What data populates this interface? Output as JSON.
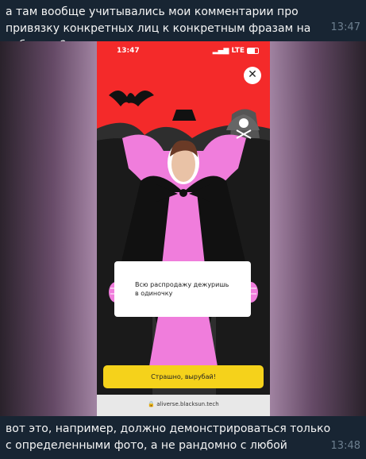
{
  "top_message": {
    "text": "а там вообще учитывались мои комментарии про привязку конкретных лиц к конкретным фразам на табличке?",
    "time": "13:47"
  },
  "screenshot": {
    "status_time": "13:47",
    "status_network": "LTE",
    "close_glyph": "✕",
    "card_text": "Всю распродажу дежуришь в одиночку",
    "cta_label": "Страшно, вырубай!",
    "url": "aliverse.blacksun.tech",
    "colors": {
      "background_red": "#f42a2a",
      "cape_pink": "#f07ddc",
      "cape_black": "#111111",
      "cta_yellow": "#f5d21b"
    }
  },
  "bottom_message": {
    "text": "вот это, например, должно демонстрироваться только с определенными фото, а не рандомно с любой",
    "time": "13:48"
  }
}
